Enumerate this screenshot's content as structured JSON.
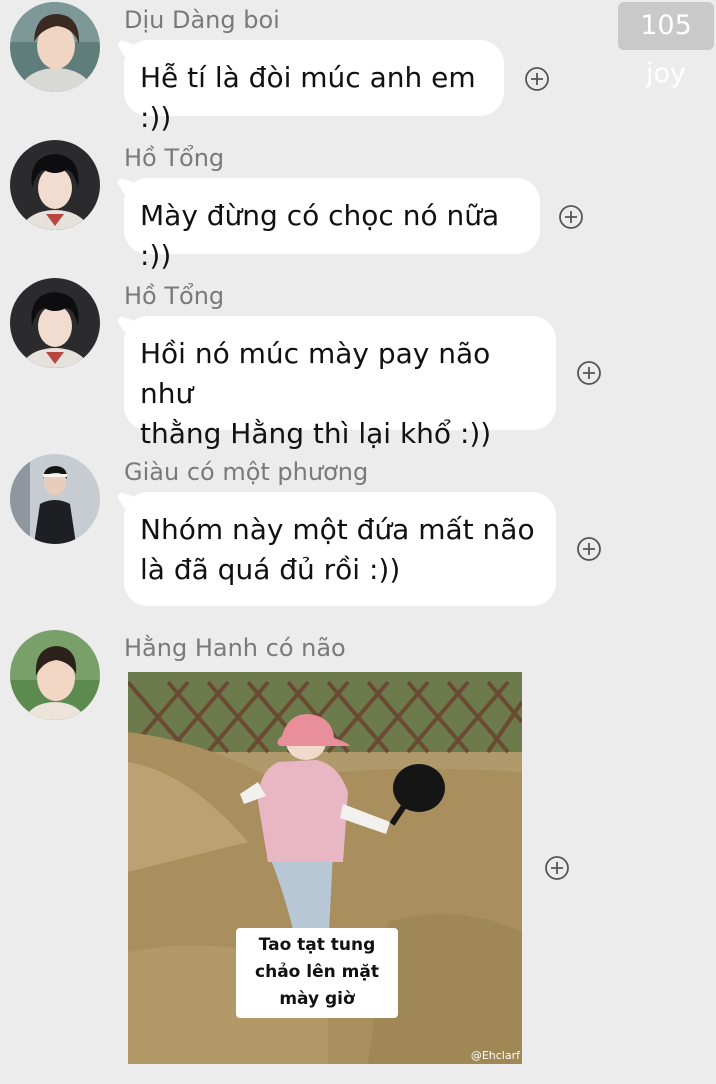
{
  "badge_text": "105 joy",
  "messages": [
    {
      "sender": "Dịu Dàng boi",
      "text": "Hễ tí là đòi múc anh em :))",
      "react_icon": "add-reaction-icon"
    },
    {
      "sender": "Hồ Tổng",
      "text": "Mày đừng có chọc nó nữa :))",
      "react_icon": "add-reaction-icon"
    },
    {
      "sender": "Hồ Tổng",
      "text_lines": [
        "Hồi nó múc mày pay não như",
        "thằng Hằng thì lại khổ :))"
      ],
      "react_icon": "add-reaction-icon"
    },
    {
      "sender": "Giàu có một phương",
      "text_lines": [
        "Nhóm này một đứa mất não",
        "là đã quá đủ rồi :))"
      ],
      "react_icon": "add-reaction-icon"
    },
    {
      "sender": "Hằng Hanh có não",
      "image": {
        "caption_lines": [
          "Tao tạt tung",
          "chảo lên mặt",
          "mày giờ"
        ],
        "watermark": "@Ehclarf"
      },
      "react_icon": "add-reaction-icon"
    }
  ],
  "colors": {
    "background": "#ececec",
    "bubble": "#ffffff",
    "sender_name": "#7a7a7a",
    "text": "#111111",
    "badge": "#c9c9c9"
  }
}
